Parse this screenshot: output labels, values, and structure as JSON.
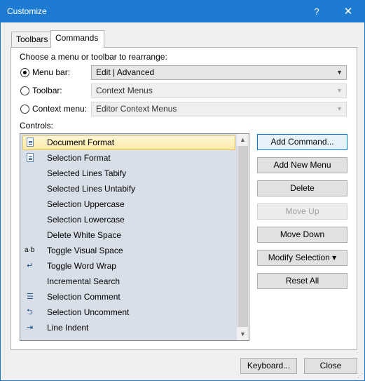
{
  "window": {
    "title": "Customize",
    "help_label": "?",
    "close_label": "✕"
  },
  "tabs": [
    {
      "label": "Toolbars"
    },
    {
      "label": "Commands"
    }
  ],
  "rearrange_label": "Choose a menu or toolbar to rearrange:",
  "options": {
    "menu_bar": {
      "label": "Menu bar:",
      "value": "Edit | Advanced",
      "checked": true
    },
    "toolbar": {
      "label": "Toolbar:",
      "value": "Context Menus",
      "checked": false
    },
    "context_menu": {
      "label": "Context menu:",
      "value": "Editor Context Menus",
      "checked": false
    }
  },
  "controls_label": "Controls:",
  "controls": [
    {
      "label": "Document Format",
      "icon": "document-format-icon",
      "selected": true
    },
    {
      "label": "Selection Format",
      "icon": "selection-format-icon",
      "selected": false
    },
    {
      "label": "Selected Lines Tabify",
      "icon": "",
      "selected": false
    },
    {
      "label": "Selected Lines Untabify",
      "icon": "",
      "selected": false
    },
    {
      "label": "Selection Uppercase",
      "icon": "",
      "selected": false
    },
    {
      "label": "Selection Lowercase",
      "icon": "",
      "selected": false
    },
    {
      "label": "Delete White Space",
      "icon": "",
      "selected": false
    },
    {
      "label": "Toggle Visual Space",
      "icon": "visual-space-icon",
      "selected": false
    },
    {
      "label": "Toggle Word Wrap",
      "icon": "word-wrap-icon",
      "selected": false
    },
    {
      "label": "Incremental Search",
      "icon": "",
      "selected": false
    },
    {
      "label": "Selection Comment",
      "icon": "comment-icon",
      "selected": false
    },
    {
      "label": "Selection Uncomment",
      "icon": "uncomment-icon",
      "selected": false
    },
    {
      "label": "Line Indent",
      "icon": "indent-icon",
      "selected": false
    }
  ],
  "buttons": {
    "add_command": "Add Command...",
    "add_new_menu": "Add New Menu",
    "delete": "Delete",
    "move_up": "Move Up",
    "move_down": "Move Down",
    "modify_selection": "Modify Selection ▾",
    "reset_all": "Reset All",
    "keyboard": "Keyboard...",
    "close": "Close"
  }
}
